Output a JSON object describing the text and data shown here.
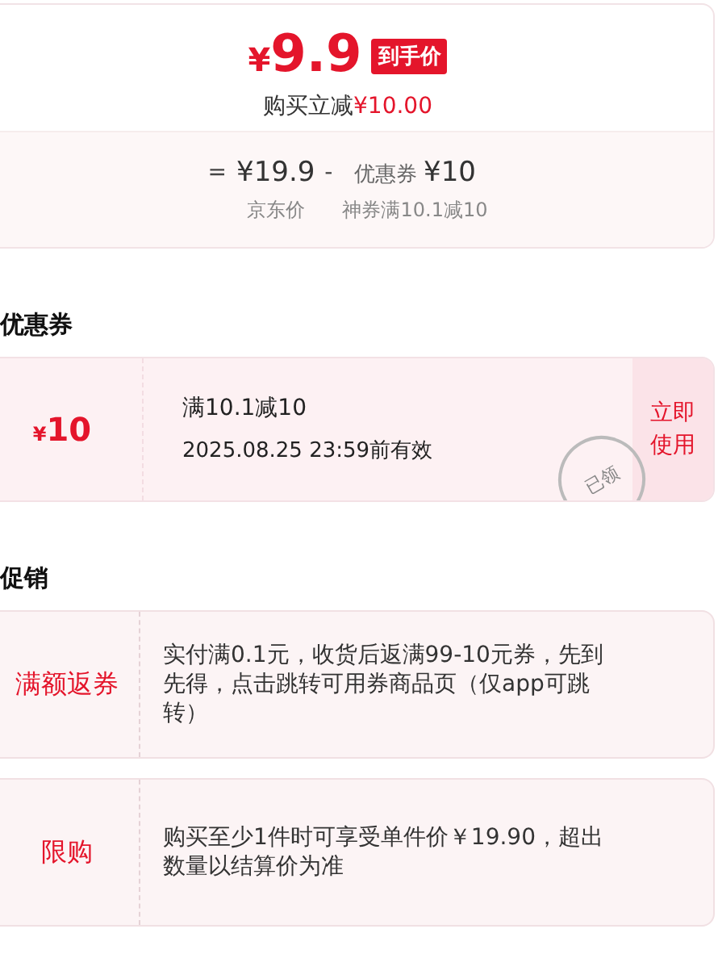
{
  "price_card": {
    "price_symbol": "¥",
    "price": "9.9",
    "badge": "到手价",
    "discount_label": "购买立减",
    "discount_amount": "¥10.00",
    "equals": "=",
    "original_price": "¥19.9",
    "original_label": "京东价",
    "minus": "-",
    "coupon_label": "优惠券",
    "coupon_amount": "¥10",
    "coupon_note": "神券满10.1减10"
  },
  "coupon_section": {
    "title": "优惠券",
    "coupon": {
      "symbol": "¥",
      "amount": "10",
      "condition": "满10.1减10",
      "validity": "2025.08.25 23:59前有效",
      "claimed": true,
      "stamp": "已领",
      "action": "立即使用"
    }
  },
  "promo_section": {
    "title": "促销",
    "promotions": [
      {
        "tag": "满额返券",
        "text": "实付满0.1元，收货后返满99-10元券，先到先得，点击跳转可用券商品页（仅app可跳转）"
      },
      {
        "tag": "限购",
        "text": "购买至少1件时可享受单件价￥19.90，超出数量以结算价为准"
      }
    ]
  }
}
